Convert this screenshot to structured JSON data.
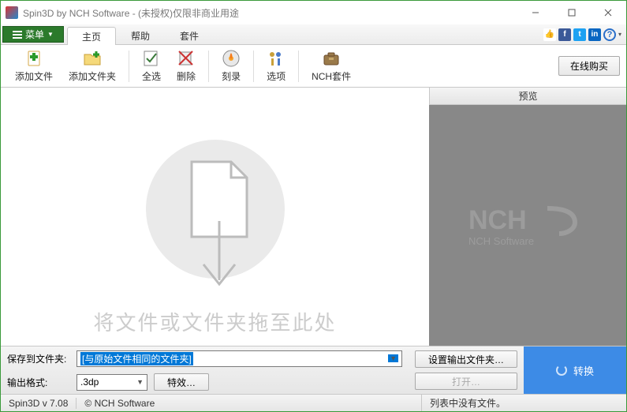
{
  "title": "Spin3D by NCH Software - (未授权)仅限非商业用途",
  "menu": {
    "button": "菜单",
    "tabs": [
      "主页",
      "帮助",
      "套件"
    ]
  },
  "social": {
    "like_color": "#3b5998",
    "fb": "f",
    "tw": "t",
    "in": "in"
  },
  "toolbar": {
    "add_file": "添加文件",
    "add_folder": "添加文件夹",
    "select_all": "全选",
    "delete": "删除",
    "burn": "刻录",
    "options": "选项",
    "nch_suite": "NCH套件",
    "online_buy": "在线购买"
  },
  "drop_hint": "将文件或文件夹拖至此处",
  "preview": {
    "header": "预览",
    "logo_text": "NCH Software"
  },
  "save_to": {
    "label": "保存到文件夹:",
    "value": "[与原始文件相同的文件夹]"
  },
  "output_format": {
    "label": "输出格式:",
    "value": ".3dp",
    "effects": "特效…"
  },
  "buttons": {
    "set_output": "设置输出文件夹…",
    "open": "打开…",
    "convert": "转换"
  },
  "status": {
    "version": "Spin3D v 7.08",
    "copyright": "© NCH Software",
    "right": "列表中没有文件。"
  }
}
